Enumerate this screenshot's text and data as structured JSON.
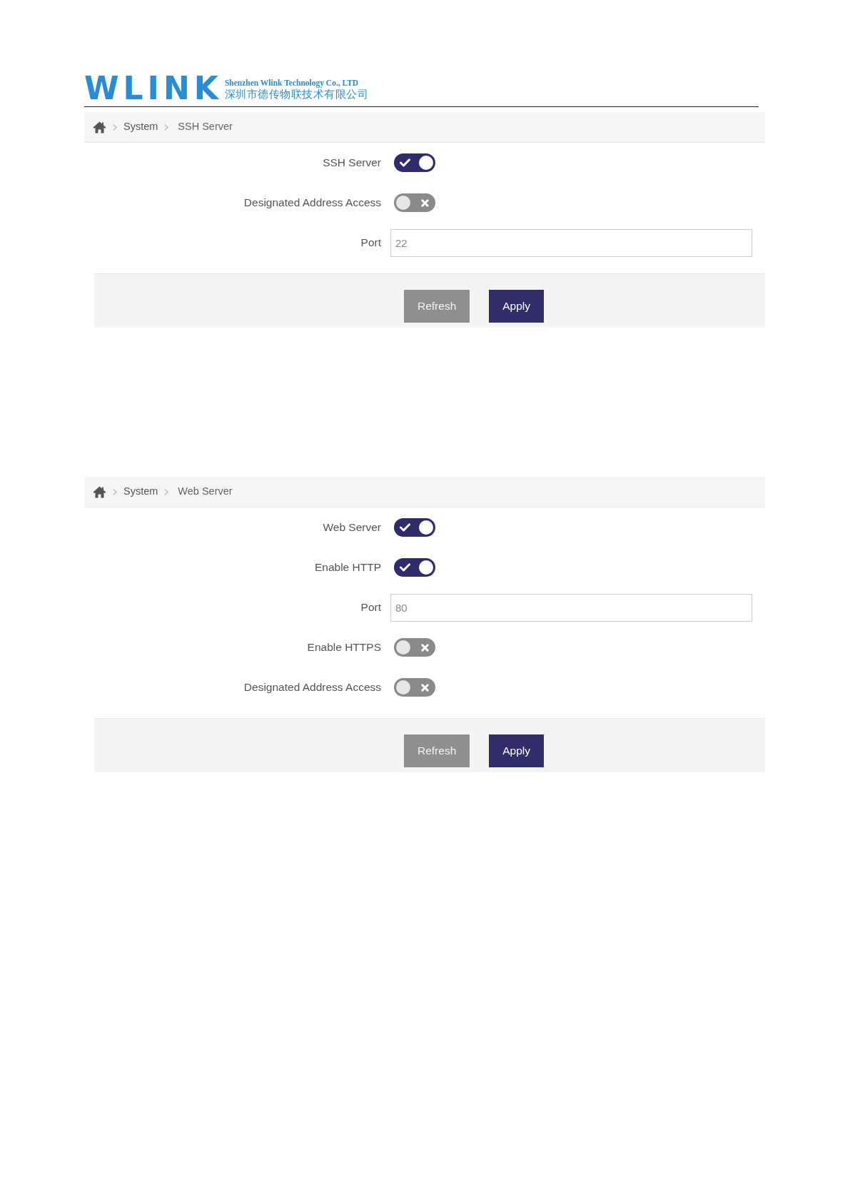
{
  "header": {
    "logo": "WLINK",
    "company_en": "Shenzhen Wlink Technology Co., LTD",
    "company_cn": "深圳市德传物联技术有限公司"
  },
  "panels": [
    {
      "breadcrumb": [
        "System",
        "SSH Server"
      ],
      "fields": [
        {
          "kind": "toggle",
          "label": "SSH Server",
          "on": true
        },
        {
          "kind": "toggle",
          "label": "Designated Address Access",
          "on": false
        },
        {
          "kind": "text",
          "label": "Port",
          "value": "22"
        }
      ],
      "buttons": [
        {
          "kind": "secondary",
          "label": "Refresh"
        },
        {
          "kind": "primary",
          "label": "Apply"
        }
      ]
    },
    {
      "breadcrumb": [
        "System",
        "Web Server"
      ],
      "fields": [
        {
          "kind": "toggle",
          "label": "Web Server",
          "on": true
        },
        {
          "kind": "toggle",
          "label": "Enable HTTP",
          "on": true
        },
        {
          "kind": "text",
          "label": "Port",
          "value": "80"
        },
        {
          "kind": "toggle",
          "label": "Enable HTTPS",
          "on": false
        },
        {
          "kind": "toggle",
          "label": "Designated Address Access",
          "on": false
        }
      ],
      "buttons": [
        {
          "kind": "secondary",
          "label": "Refresh"
        },
        {
          "kind": "primary",
          "label": "Apply"
        }
      ]
    }
  ]
}
